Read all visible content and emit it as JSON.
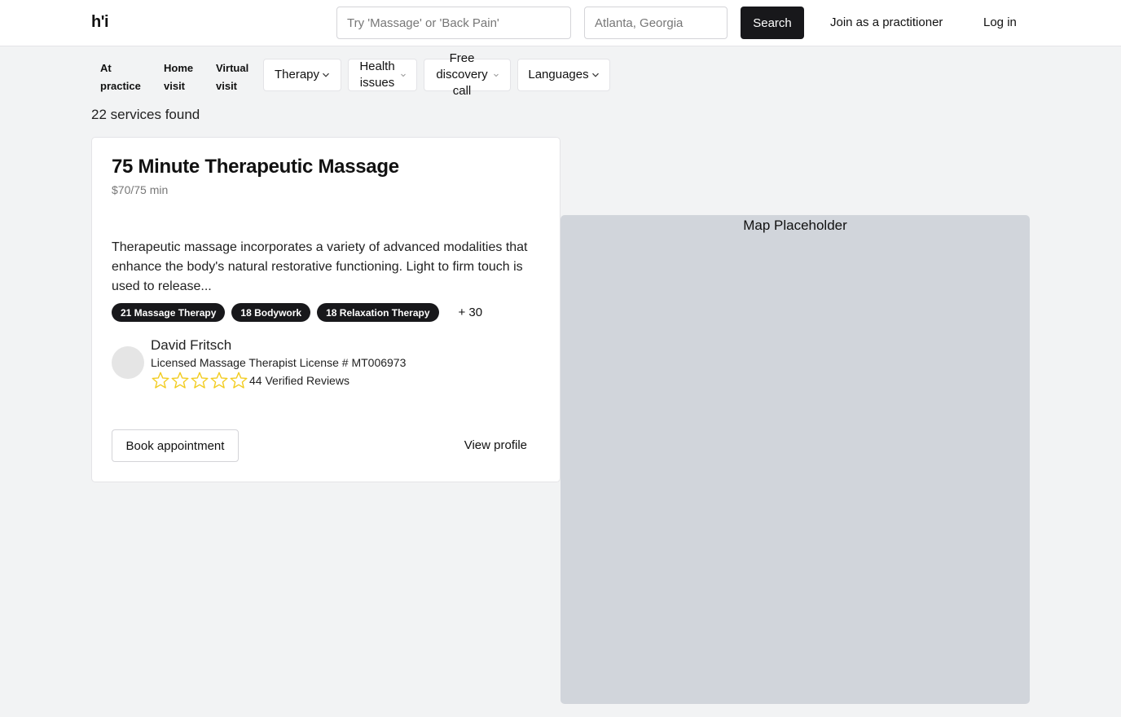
{
  "header": {
    "logo": "h'i",
    "search_placeholder": "Try 'Massage' or 'Back Pain'",
    "location_placeholder": "Atlanta, Georgia",
    "search_label": "Search",
    "join_label": "Join as a practitioner",
    "login_label": "Log in"
  },
  "filters": {
    "at_practice": "At practice",
    "home_visit": "Home visit",
    "virtual_visit": "Virtual visit",
    "therapy": "Therapy",
    "health_issues": "Health issues",
    "free_discovery_call": "Free discovery call",
    "languages": "Languages"
  },
  "results": {
    "count_label": "22 services found"
  },
  "service": {
    "title": "75 Minute Therapeutic Massage",
    "price": "$70/75 min",
    "description": "Therapeutic massage incorporates a variety of advanced modalities that enhance the body's natural restorative functioning. Light to firm touch is used to release...",
    "tags": [
      "21 Massage Therapy",
      "18 Bodywork",
      "18 Relaxation Therapy"
    ],
    "more_tags": "+ 30",
    "practitioner": {
      "name": "David Fritsch",
      "license": "Licensed Massage Therapist License # MT006973",
      "rating": 0,
      "rating_max": 5,
      "reviews": "44 Verified Reviews"
    },
    "book_label": "Book appointment",
    "view_label": "View profile"
  },
  "map": {
    "label": "Map Placeholder"
  },
  "colors": {
    "accent": "#18181b",
    "star": "#f2cc20",
    "map_bg": "#d1d5db"
  }
}
